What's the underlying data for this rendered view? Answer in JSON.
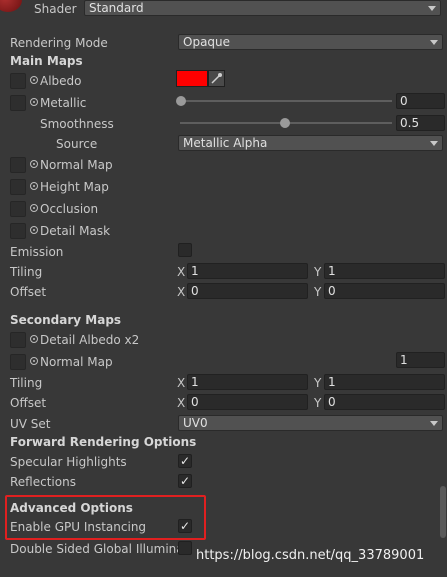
{
  "header": {
    "shader_label": "Shader",
    "shader_value": "Standard"
  },
  "rendering_mode": {
    "label": "Rendering Mode",
    "value": "Opaque"
  },
  "main_maps": {
    "title": "Main Maps",
    "albedo": {
      "label": "Albedo",
      "color": "#ff0000"
    },
    "metallic": {
      "label": "Metallic",
      "value": "0",
      "slider_fraction": 0.0
    },
    "smoothness": {
      "label": "Smoothness",
      "value": "0.5",
      "slider_fraction": 0.5
    },
    "source": {
      "label": "Source",
      "value": "Metallic Alpha"
    },
    "normal_map": {
      "label": "Normal Map"
    },
    "height_map": {
      "label": "Height Map"
    },
    "occlusion": {
      "label": "Occlusion"
    },
    "detail_mask": {
      "label": "Detail Mask"
    },
    "emission": {
      "label": "Emission"
    },
    "tiling": {
      "label": "Tiling",
      "x_label": "X",
      "x": "1",
      "y_label": "Y",
      "y": "1"
    },
    "offset": {
      "label": "Offset",
      "x_label": "X",
      "x": "0",
      "y_label": "Y",
      "y": "0"
    }
  },
  "secondary_maps": {
    "title": "Secondary Maps",
    "detail_albedo": {
      "label": "Detail Albedo x2"
    },
    "normal_map": {
      "label": "Normal Map",
      "value": "1"
    },
    "tiling": {
      "label": "Tiling",
      "x_label": "X",
      "x": "1",
      "y_label": "Y",
      "y": "1"
    },
    "offset": {
      "label": "Offset",
      "x_label": "X",
      "x": "0",
      "y_label": "Y",
      "y": "0"
    },
    "uv_set": {
      "label": "UV Set",
      "value": "UV0"
    }
  },
  "forward_rendering": {
    "title": "Forward Rendering Options",
    "specular": {
      "label": "Specular Highlights",
      "checked": true,
      "mark": "✓"
    },
    "reflections": {
      "label": "Reflections",
      "checked": true,
      "mark": "✓"
    }
  },
  "advanced": {
    "title": "Advanced Options",
    "gpu_instancing": {
      "label": "Enable GPU Instancing",
      "checked": true,
      "mark": "✓"
    },
    "double_sided": {
      "label": "Double Sided Global Illumination"
    }
  },
  "watermark": "https://blog.csdn.net/qq_33789001",
  "colors": {
    "background": "#383838",
    "highlight_box": "#e02020"
  },
  "icons": {
    "eyedropper": "eyedropper-icon",
    "material": "material-sphere-icon"
  }
}
